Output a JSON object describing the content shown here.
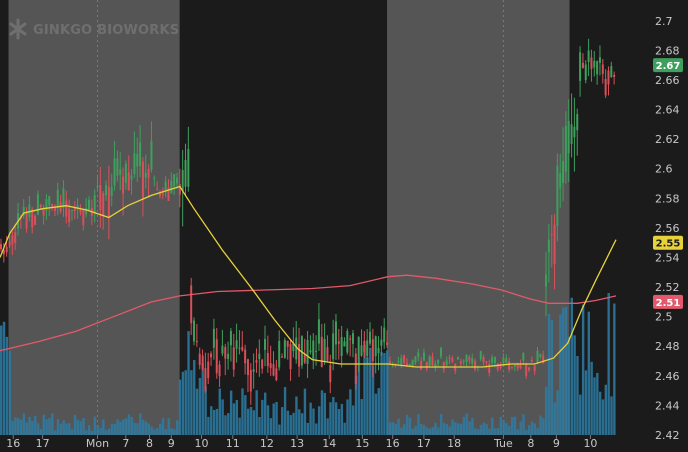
{
  "app": {
    "logo_text": "GINKGO BIOWORKS"
  },
  "colors": {
    "background_extended": "#1b1b1b",
    "background_regular": "#555555",
    "candle_up": "#3f9f5d",
    "candle_down": "#d9505a",
    "volume": "#2d7ea7",
    "ma_short": "#e7d23c",
    "ma_long": "#e2596b",
    "tag_text_dark": "#1a1a1a",
    "tag_text_light": "#ffffff"
  },
  "chart_data": {
    "type": "candlestick",
    "title": "",
    "xlabel": "",
    "ylabel": "",
    "ylim": [
      2.42,
      2.71
    ],
    "y_ticks": [
      2.42,
      2.44,
      2.46,
      2.48,
      2.5,
      2.52,
      2.54,
      2.56,
      2.58,
      2.6,
      2.62,
      2.64,
      2.66,
      2.68,
      2.7
    ],
    "x_ticks": [
      {
        "label": "16",
        "slot": 14
      },
      {
        "label": "17",
        "slot": 45
      },
      {
        "label": "Mon",
        "slot": 103
      },
      {
        "label": "7",
        "slot": 133
      },
      {
        "label": "8",
        "slot": 158
      },
      {
        "label": "9",
        "slot": 181
      },
      {
        "label": "10",
        "slot": 213
      },
      {
        "label": "11",
        "slot": 246
      },
      {
        "label": "12",
        "slot": 282
      },
      {
        "label": "13",
        "slot": 314
      },
      {
        "label": "14",
        "slot": 348
      },
      {
        "label": "15",
        "slot": 383
      },
      {
        "label": "16",
        "slot": 415
      },
      {
        "label": "17",
        "slot": 448
      },
      {
        "label": "18",
        "slot": 480
      },
      {
        "label": "Tue",
        "slot": 532
      },
      {
        "label": "8",
        "slot": 561
      },
      {
        "label": "9",
        "slot": 588
      },
      {
        "label": "10",
        "slot": 624
      }
    ],
    "slots_total": 688,
    "sessions": [
      {
        "type": "extended",
        "start": 0,
        "end": 9
      },
      {
        "type": "regular",
        "start": 9,
        "end": 190
      },
      {
        "type": "extended",
        "start": 190,
        "end": 409
      },
      {
        "type": "regular",
        "start": 409,
        "end": 602
      },
      {
        "type": "extended",
        "start": 602,
        "end": 651
      }
    ],
    "current_price": {
      "label": "2.67",
      "value": 2.67,
      "color": "#3f9f5d"
    },
    "ma_short_tag": {
      "label": "2.55",
      "value": 2.55,
      "color": "#e7d23c"
    },
    "ma_long_tag": {
      "label": "2.51",
      "value": 2.51,
      "color": "#e2596b"
    },
    "ma_short_series": [
      [
        0,
        2.54
      ],
      [
        10,
        2.556
      ],
      [
        25,
        2.57
      ],
      [
        45,
        2.573
      ],
      [
        70,
        2.575
      ],
      [
        92,
        2.572
      ],
      [
        115,
        2.567
      ],
      [
        135,
        2.575
      ],
      [
        160,
        2.582
      ],
      [
        190,
        2.588
      ],
      [
        205,
        2.573
      ],
      [
        235,
        2.545
      ],
      [
        265,
        2.52
      ],
      [
        290,
        2.498
      ],
      [
        315,
        2.478
      ],
      [
        330,
        2.471
      ],
      [
        360,
        2.468
      ],
      [
        385,
        2.468
      ],
      [
        410,
        2.468
      ],
      [
        440,
        2.466
      ],
      [
        470,
        2.466
      ],
      [
        510,
        2.466
      ],
      [
        540,
        2.468
      ],
      [
        565,
        2.468
      ],
      [
        585,
        2.472
      ],
      [
        600,
        2.482
      ],
      [
        615,
        2.505
      ],
      [
        630,
        2.525
      ],
      [
        651,
        2.552
      ]
    ],
    "ma_long_series": [
      [
        0,
        2.477
      ],
      [
        40,
        2.483
      ],
      [
        80,
        2.49
      ],
      [
        120,
        2.5
      ],
      [
        160,
        2.51
      ],
      [
        190,
        2.514
      ],
      [
        230,
        2.517
      ],
      [
        280,
        2.518
      ],
      [
        330,
        2.519
      ],
      [
        370,
        2.521
      ],
      [
        410,
        2.527
      ],
      [
        430,
        2.528
      ],
      [
        460,
        2.526
      ],
      [
        500,
        2.522
      ],
      [
        530,
        2.518
      ],
      [
        560,
        2.512
      ],
      [
        580,
        2.509
      ],
      [
        610,
        2.509
      ],
      [
        630,
        2.511
      ],
      [
        651,
        2.514
      ]
    ]
  }
}
